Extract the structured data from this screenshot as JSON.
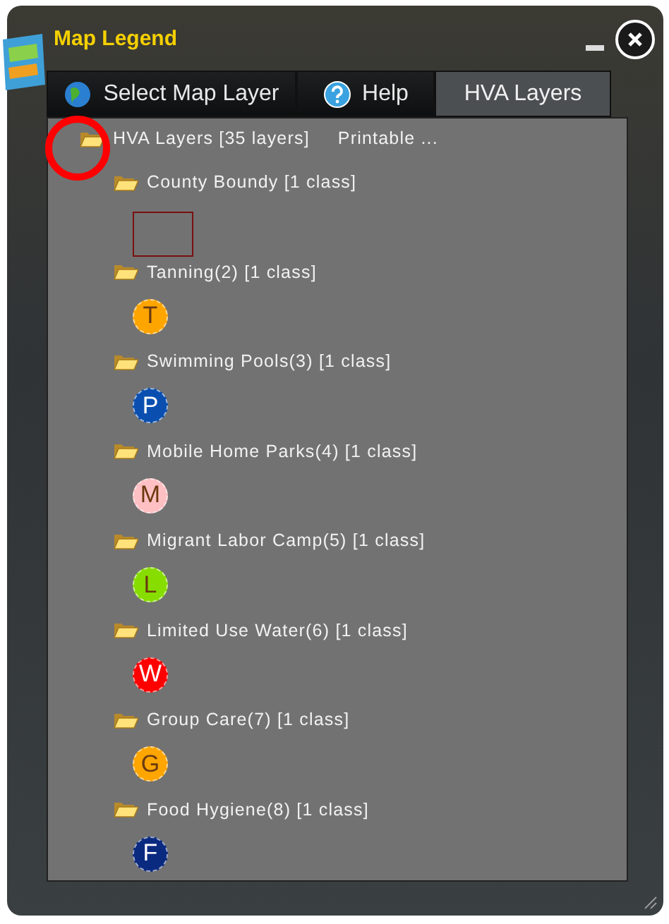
{
  "window": {
    "title": "Map Legend"
  },
  "tabs": [
    {
      "label": "Select Map Layer",
      "kind": "globe",
      "selected": false
    },
    {
      "label": "Help",
      "kind": "help",
      "selected": false
    },
    {
      "label": "HVA Layers",
      "kind": "plain",
      "selected": true
    }
  ],
  "tree": {
    "label": "HVA Layers [35 layers]",
    "action": "Printable ...",
    "highlighted": true,
    "children": [
      {
        "label": "County Boundy [1 class]",
        "symbol": {
          "kind": "square",
          "color": "#7a1010"
        }
      },
      {
        "label": "Tanning(2) [1 class]",
        "symbol": {
          "kind": "circle",
          "letter": "T",
          "color": "#ffa500"
        }
      },
      {
        "label": "Swimming Pools(3) [1 class]",
        "symbol": {
          "kind": "circle",
          "letter": "P",
          "color": "#0a4fb0"
        }
      },
      {
        "label": "Mobile Home Parks(4) [1 class]",
        "symbol": {
          "kind": "circle",
          "letter": "M",
          "color": "#ffc0c4"
        }
      },
      {
        "label": "Migrant Labor Camp(5) [1 class]",
        "symbol": {
          "kind": "circle",
          "letter": "L",
          "color": "#88dd00"
        }
      },
      {
        "label": "Limited Use Water(6) [1 class]",
        "symbol": {
          "kind": "circle",
          "letter": "W",
          "color": "#ff0000"
        }
      },
      {
        "label": "Group Care(7) [1 class]",
        "symbol": {
          "kind": "circle",
          "letter": "G",
          "color": "#ffa500"
        }
      },
      {
        "label": "Food Hygiene(8) [1 class]",
        "symbol": {
          "kind": "circle",
          "letter": "F",
          "color": "#0a2a80"
        }
      }
    ]
  }
}
